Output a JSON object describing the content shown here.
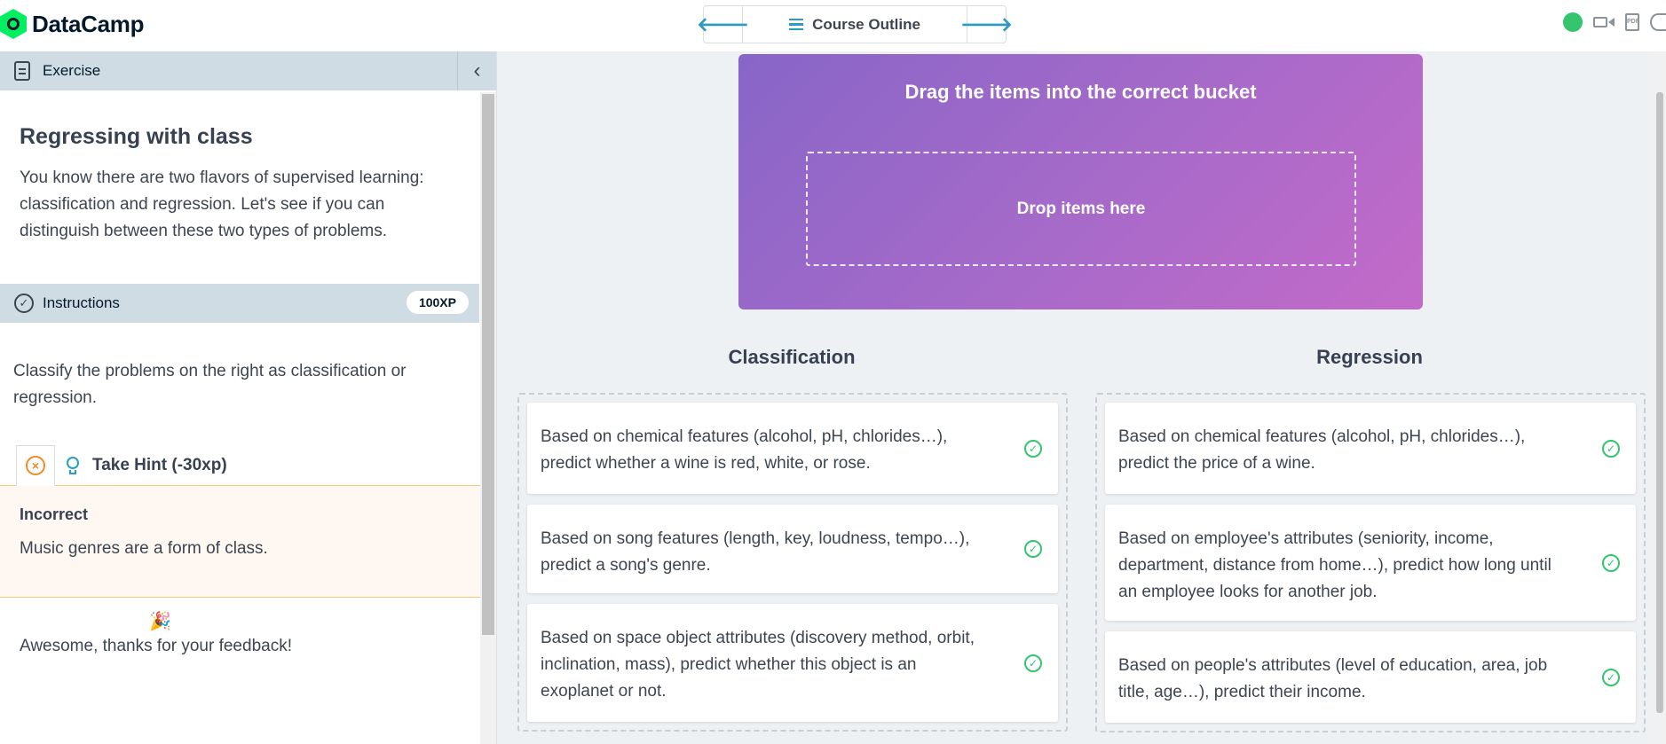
{
  "app": {
    "brand": "DataCamp"
  },
  "header": {
    "outline_label": "Course Outline",
    "prev_arrow": "🡐",
    "next_arrow": "🡒"
  },
  "left": {
    "exercise_tab": "Exercise",
    "title": "Regressing with class",
    "body": "You know there are two flavors of supervised learning: classification and regression. Let's see if you can distinguish between these two types of problems.",
    "instructions_tab": "Instructions",
    "xp": "100XP",
    "instructions": "Classify the problems on the right as classification or regression.",
    "hint_label": "Take Hint (-30xp)",
    "feedback": {
      "title": "Incorrect",
      "text": "Music genres are a form of class."
    },
    "thanks": "Awesome, thanks for your feedback!"
  },
  "drag": {
    "title": "Drag the items into the correct bucket",
    "drop_text": "Drop items here"
  },
  "buckets": [
    {
      "title": "Classification",
      "items": [
        "Based on chemical features (alcohol, pH, chlorides…), predict whether a wine is red, white, or rose.",
        "Based on song features (length, key, loudness, tempo…), predict a song's genre.",
        "Based on space object attributes (discovery method, orbit, inclination, mass), predict whether this object is an exoplanet or not."
      ]
    },
    {
      "title": "Regression",
      "items": [
        "Based on chemical features (alcohol, pH, chlorides…), predict the price of a wine.",
        "Based on employee's attributes (seniority, income, department, distance from home…), predict how long until an employee looks for another job.",
        "Based on people's attributes (level of education, area, job title, age…), predict their income."
      ]
    }
  ],
  "colors": {
    "accent": "#2a9cc4",
    "brand_green": "#03ef62",
    "success": "#35c56e",
    "warning": "#f08a24",
    "gradient_start": "#8766c8",
    "gradient_end": "#c36ac9"
  },
  "icons": {
    "logo": "datacamp-logo-icon",
    "menu": "hamburger-icon",
    "status": "status-dot-icon",
    "video": "video-icon",
    "pdf": "pdf-icon",
    "help": "help-icon",
    "exercise": "document-icon",
    "collapse": "chevron-left-icon",
    "instructions": "check-circle-icon",
    "hint_close": "close-circle-icon",
    "hint": "lightbulb-icon",
    "party": "party-popper-icon",
    "correct": "check-circle-icon"
  }
}
